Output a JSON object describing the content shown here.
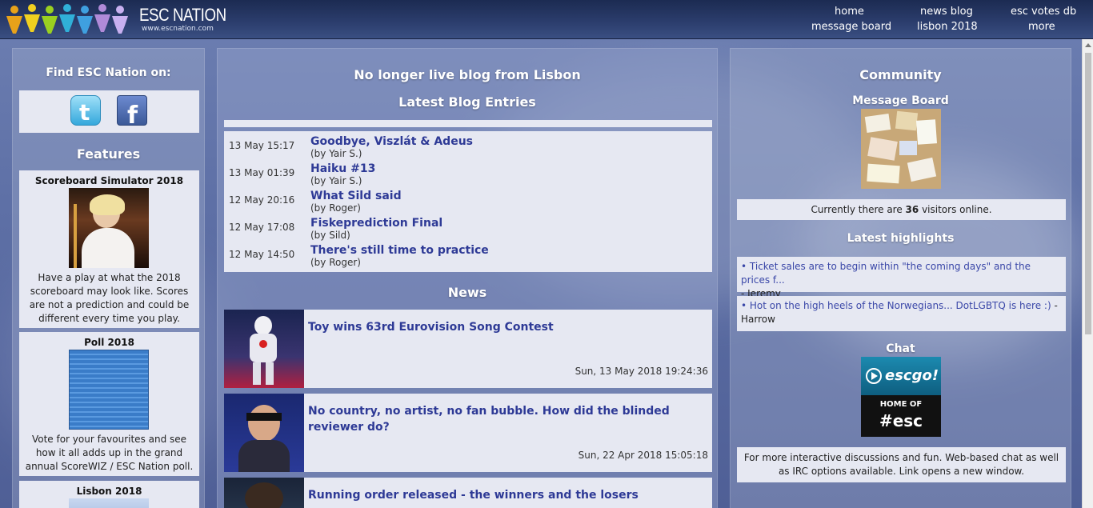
{
  "header": {
    "logo_title": "ESC NATION",
    "logo_url": "www.escnation.com",
    "nav": [
      "home",
      "news blog",
      "esc votes db",
      "message board",
      "lisbon 2018",
      "more"
    ]
  },
  "left": {
    "find_heading": "Find ESC Nation on:",
    "social": [
      "twitter-icon",
      "facebook-icon"
    ],
    "features_heading": "Features",
    "features": [
      {
        "title": "Scoreboard Simulator 2018",
        "text": "Have a play at what the 2018 scoreboard may look like. Scores are not a prediction and could be different every time you play."
      },
      {
        "title": "Poll 2018",
        "text": "Vote for your favourites and see how it all adds up in the grand annual ScoreWIZ / ESC Nation poll."
      },
      {
        "title": "Lisbon 2018",
        "text": ""
      }
    ]
  },
  "middle": {
    "heading1": "No longer live blog from Lisbon",
    "heading2": "Latest Blog Entries",
    "blog": [
      {
        "date": "13 May 15:17",
        "title": "Goodbye, Viszlát & Adeus",
        "by": "(by Yair S.)"
      },
      {
        "date": "13 May 01:39",
        "title": "Haiku #13",
        "by": "(by Yair S.)"
      },
      {
        "date": "12 May 20:16",
        "title": "What Sild said",
        "by": "(by Roger)"
      },
      {
        "date": "12 May 17:08",
        "title": "Fiskeprediction Final",
        "by": "(by Sild)"
      },
      {
        "date": "12 May 14:50",
        "title": "There's still time to practice",
        "by": "(by Roger)"
      }
    ],
    "news_heading": "News",
    "news": [
      {
        "title": "Toy wins 63rd Eurovision Song Contest",
        "date": "Sun, 13 May 2018 19:24:36"
      },
      {
        "title": "No country, no artist, no fan bubble. How did the blinded reviewer do?",
        "date": "Sun, 22 Apr 2018 15:05:18"
      },
      {
        "title": "Running order released - the winners and the losers",
        "date": ""
      }
    ]
  },
  "right": {
    "community_heading": "Community",
    "message_board_title": "Message Board",
    "visitors_pre": "Currently there are ",
    "visitors_count": "36",
    "visitors_post": " visitors online.",
    "highlights_heading": "Latest highlights",
    "highlights": [
      {
        "link": "• Ticket sales are to begin within \"the coming days\" and the prices f...",
        "by": "- Jeremy"
      },
      {
        "link": "• Hot on the high heels of the Norwegians... DotLGBTQ is here :)",
        "by": " - Harrow"
      }
    ],
    "chat_title": "Chat",
    "chat_logo_text": "escgo!",
    "chat_home_of": "HOME OF",
    "chat_tag": "#esc",
    "chat_text": "For more interactive discussions and fun. Web-based chat as well as IRC options available. Link opens a new window."
  }
}
